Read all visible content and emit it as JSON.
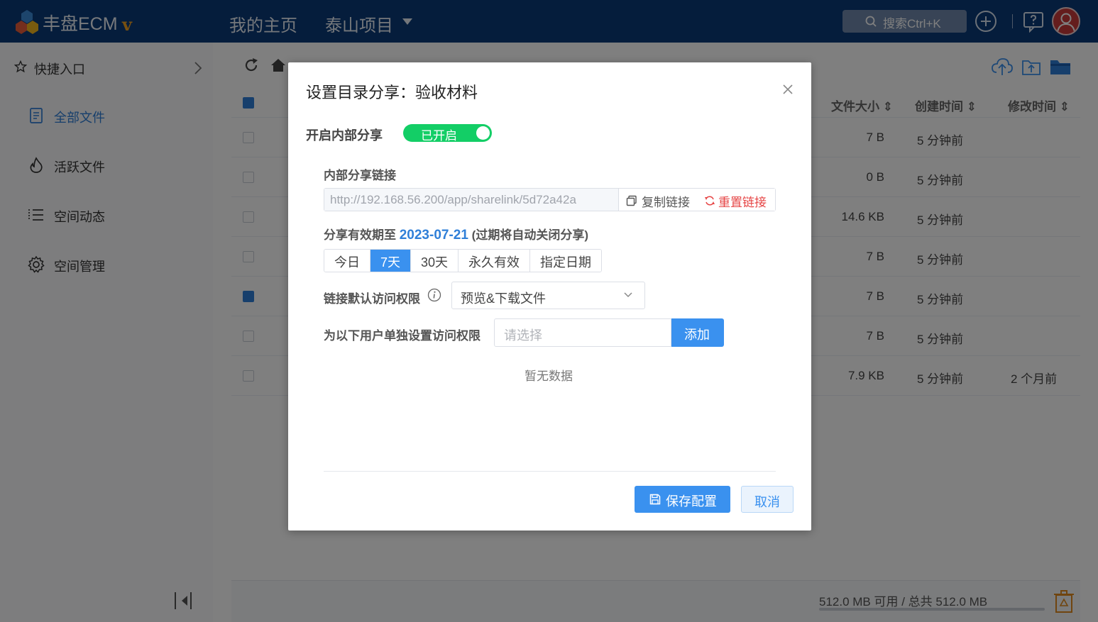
{
  "app": {
    "name": "丰盘ECM",
    "version_mark": "v"
  },
  "header": {
    "nav": [
      {
        "label": "我的主页"
      },
      {
        "label": "泰山项目"
      }
    ],
    "search_label": "搜索Ctrl+K"
  },
  "sidebar": {
    "quick_access": "快捷入口",
    "items": [
      {
        "label": "全部文件",
        "icon": "document-icon"
      },
      {
        "label": "活跃文件",
        "icon": "fire-icon"
      },
      {
        "label": "空间动态",
        "icon": "activity-list-icon"
      },
      {
        "label": "空间管理",
        "icon": "gear-icon"
      }
    ]
  },
  "table": {
    "columns": {
      "size": "文件大小",
      "created": "创建时间",
      "modified": "修改时间"
    },
    "rows": [
      {
        "size": "7 B",
        "created": "5 分钟前",
        "modified": "",
        "checked": false
      },
      {
        "size": "0 B",
        "created": "5 分钟前",
        "modified": "",
        "checked": false
      },
      {
        "size": "14.6 KB",
        "created": "5 分钟前",
        "modified": "",
        "checked": false
      },
      {
        "size": "7 B",
        "created": "5 分钟前",
        "modified": "",
        "checked": false
      },
      {
        "size": "7 B",
        "created": "5 分钟前",
        "modified": "",
        "checked": true
      },
      {
        "size": "7 B",
        "created": "5 分钟前",
        "modified": "",
        "checked": false
      },
      {
        "size": "7.9 KB",
        "created": "5 分钟前",
        "modified": "2 个月前",
        "checked": false
      }
    ]
  },
  "footer": {
    "quota": "512.0 MB 可用 / 总共 512.0 MB"
  },
  "dialog": {
    "title": "设置目录分享：验收材料",
    "internal_share_label": "开启内部分享",
    "switch_label": "已开启",
    "link_label": "内部分享链接",
    "link_value": "http://192.168.56.200/app/sharelink/5d72a42a",
    "copy_label": "复制链接",
    "reset_label": "重置链接",
    "expire_prefix": "分享有效期至",
    "expire_date": "2023-07-21",
    "expire_note": "(过期将自动关闭分享)",
    "durations": [
      "今日",
      "7天",
      "30天",
      "永久有效",
      "指定日期"
    ],
    "duration_active_index": 1,
    "default_perm_label": "链接默认访问权限",
    "default_perm_value": "预览&下载文件",
    "user_perm_label": "为以下用户单独设置访问权限",
    "user_select_placeholder": "请选择",
    "add_label": "添加",
    "empty_text": "暂无数据",
    "save_label": "保存配置",
    "cancel_label": "取消"
  },
  "colors": {
    "header_bg": "#0b3b78",
    "primary": "#3a91ef",
    "switch_on": "#13ce66",
    "danger": "#e64545"
  }
}
